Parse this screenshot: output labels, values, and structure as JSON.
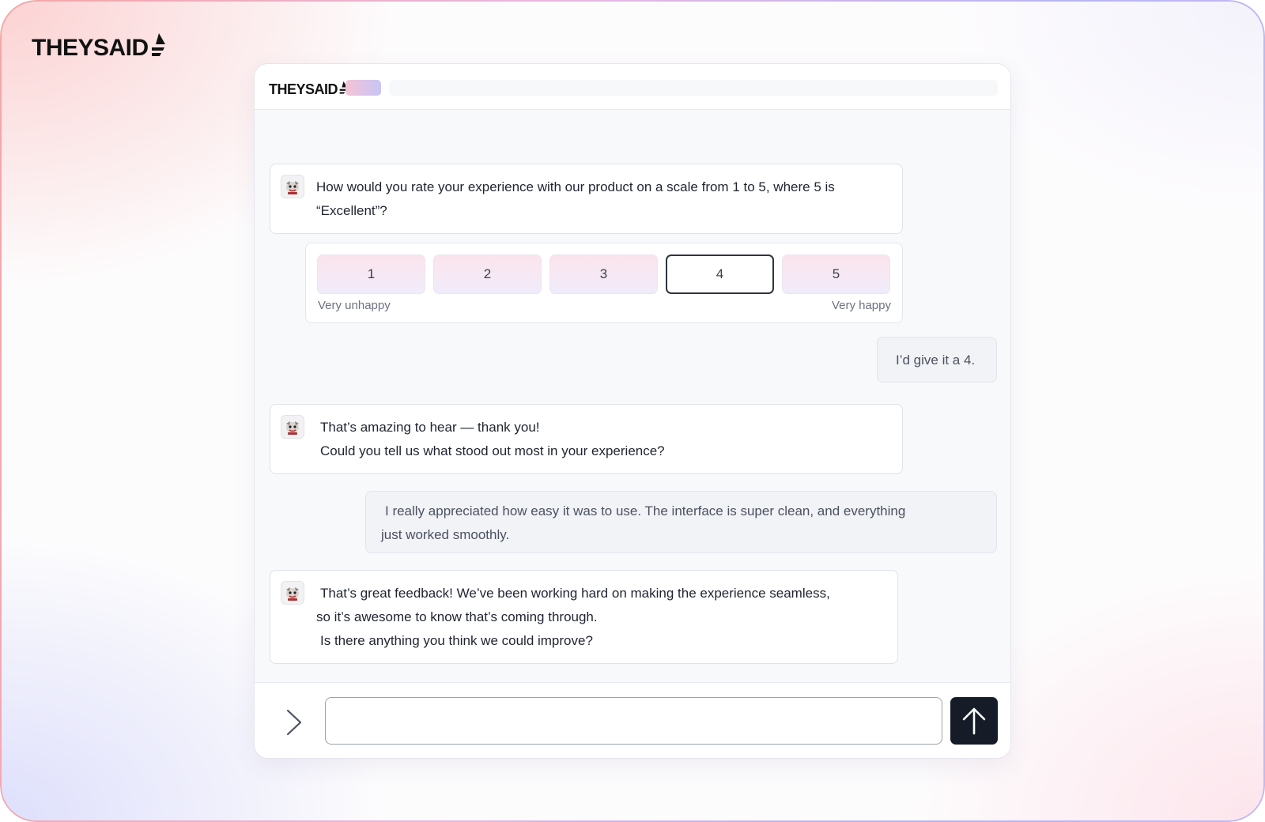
{
  "brand": {
    "name": "THEYSAID"
  },
  "chat": {
    "messages": [
      {
        "from": "bot",
        "lines": [
          "How would you rate your experience with our product on a scale from 1 to 5, where 5 is",
          "“Excellent”?"
        ]
      },
      {
        "from": "user",
        "lines": [
          "I’d give it a 4."
        ]
      },
      {
        "from": "bot",
        "lines": [
          "That’s amazing to hear — thank you!",
          "Could you tell us what stood out most in your experience?"
        ]
      },
      {
        "from": "user",
        "lines": [
          "I really appreciated how easy it was to use. The interface is super clean, and everything",
          "just worked smoothly."
        ]
      },
      {
        "from": "bot",
        "lines": [
          "That’s great feedback! We’ve been working hard on making the experience seamless,",
          "so it’s awesome to know that’s coming through.",
          "Is there anything you think we could improve?"
        ]
      }
    ]
  },
  "rating": {
    "options": [
      "1",
      "2",
      "3",
      "4",
      "5"
    ],
    "selected": "4",
    "min_label": "Very unhappy",
    "max_label": "Very happy"
  },
  "composer": {
    "value": "",
    "placeholder": ""
  },
  "icons": {
    "avatar": "bot-avatar-icon",
    "chevron": "chevron-right-icon",
    "send": "arrow-up-icon",
    "logo_mark": "sail-icon"
  },
  "colors": {
    "send_button": "#151c28",
    "rating_gradient_start": "#fbe4ec",
    "rating_gradient_end": "#f1ecfb",
    "border_gradient_start": "#f5a6a6",
    "border_gradient_end": "#b8b6f3"
  }
}
